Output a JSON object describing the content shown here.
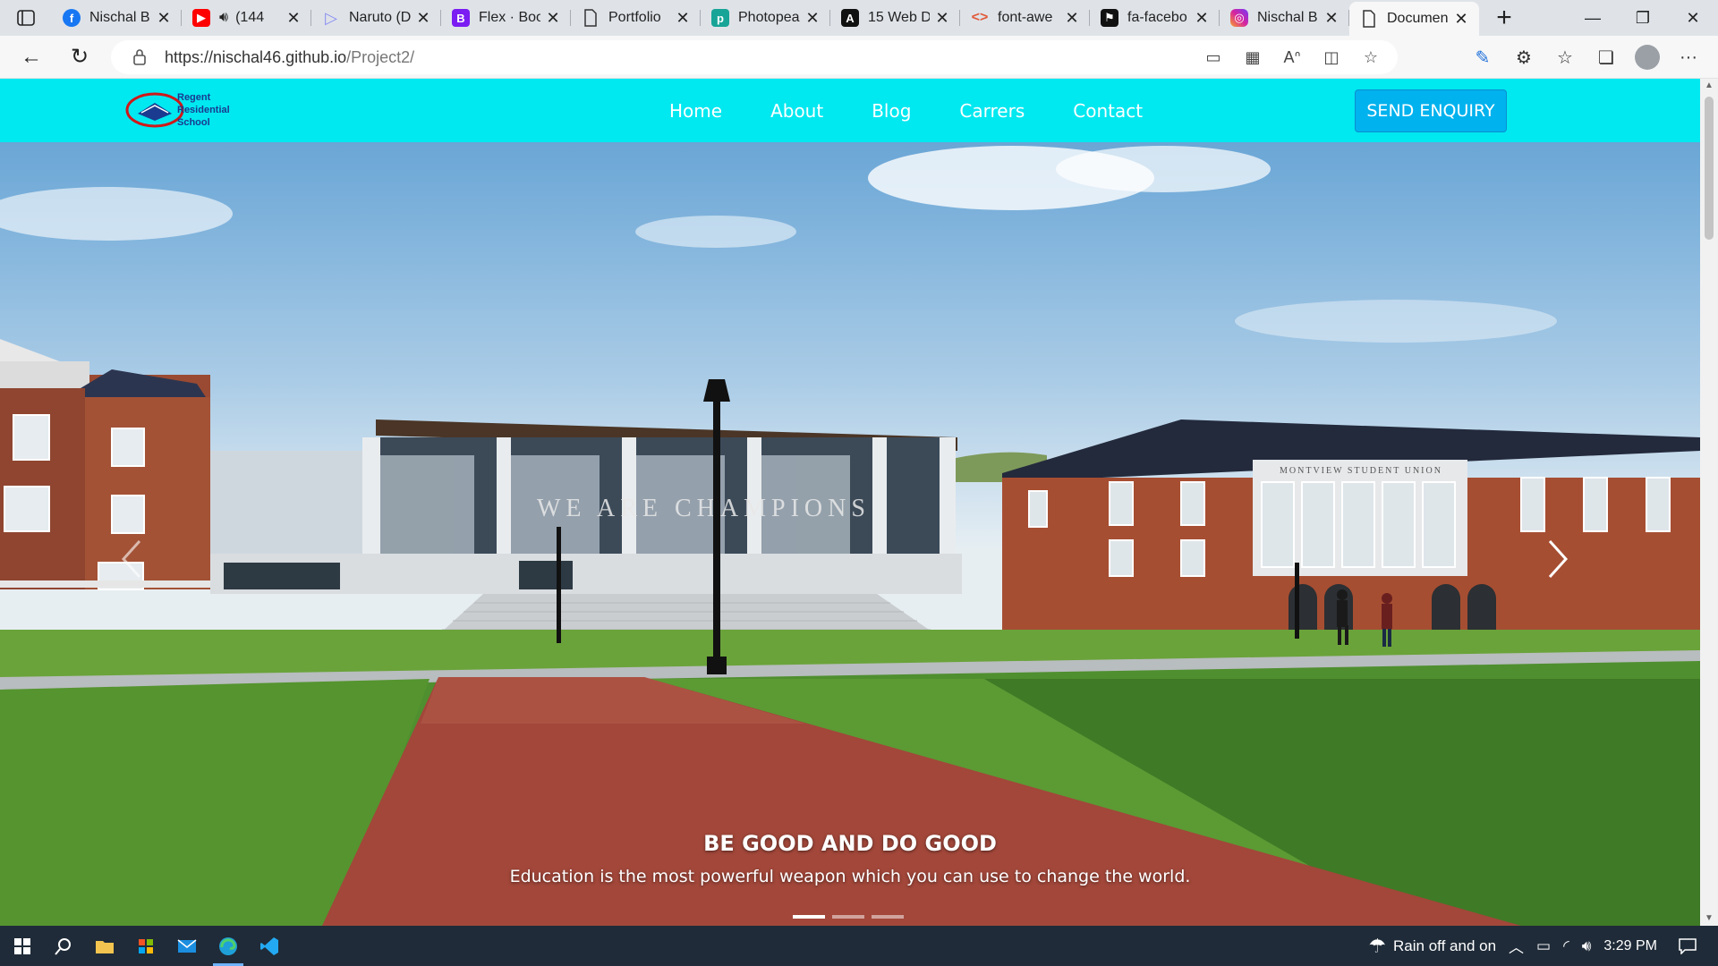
{
  "browser": {
    "tabs": [
      {
        "title": "Nischal B",
        "favicon": "facebook-icon",
        "color": "#1877f2"
      },
      {
        "title": "(144",
        "favicon": "youtube-icon",
        "color": "#ff0000",
        "audio": true
      },
      {
        "title": "Naruto (D",
        "favicon": "video-play-icon",
        "color": "#8a8df0"
      },
      {
        "title": "Flex · Boo",
        "favicon": "bootstrap-icon",
        "color": "#7a1cf2"
      },
      {
        "title": "Portfolio",
        "favicon": "page-icon",
        "color": "#555555"
      },
      {
        "title": "Photopea",
        "favicon": "photopea-icon",
        "color": "#18a497"
      },
      {
        "title": "15 Web D",
        "favicon": "web-dev-icon",
        "color": "#111111"
      },
      {
        "title": "font-awe",
        "favicon": "code-icon",
        "color": "#e05a3a"
      },
      {
        "title": "fa-facebo",
        "favicon": "flag-icon",
        "color": "#111111"
      },
      {
        "title": "Nischal B",
        "favicon": "instagram-icon",
        "color": "#d6249f"
      },
      {
        "title": "Documen",
        "favicon": "page-icon",
        "color": "#555555",
        "active": true
      }
    ],
    "url_host": "https://nischal46.github.io",
    "url_path": "/Project2/"
  },
  "site": {
    "logo": {
      "line1": "Regent",
      "line2": "Residential",
      "line3": "School"
    },
    "nav": [
      "Home",
      "About",
      "Blog",
      "Carrers",
      "Contact"
    ],
    "cta": "SEND ENQUIRY",
    "hero": {
      "building_sign": "WE ARE CHAMPIONS",
      "union_sign": "MONTVIEW STUDENT UNION",
      "caption_title": "BE GOOD AND DO GOOD",
      "caption_text": "Education is the most powerful weapon which you can use to change the world.",
      "slides_total": 3,
      "slide_active": 1
    }
  },
  "taskbar": {
    "weather": "Rain off and on",
    "time": "3:29 PM"
  },
  "colors": {
    "nav_bg": "#00e8f0",
    "cta_bg": "#00b2ee",
    "taskbar_bg": "#1f2b38"
  }
}
